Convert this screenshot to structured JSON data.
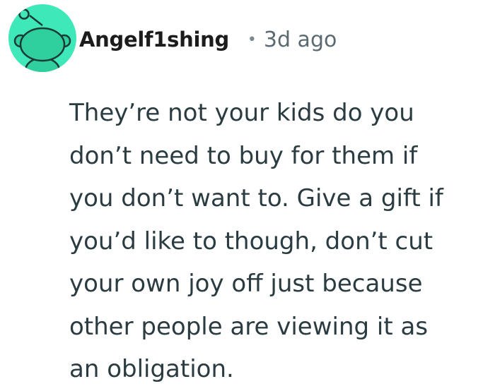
{
  "comment": {
    "author": "Angelf1shing",
    "separator": "•",
    "timestamp": "3d ago",
    "avatar_icon": "reddit-snoo-icon",
    "avatar_bg": "#3ee8b9",
    "body_lines": [
      "They’re not your kids do you",
      "don’t need to buy for them if",
      "you don’t want to. Give a gift if",
      "you’d like to though, don’t cut",
      "your own joy off just because",
      "other people are viewing it as",
      "an obligation."
    ]
  }
}
